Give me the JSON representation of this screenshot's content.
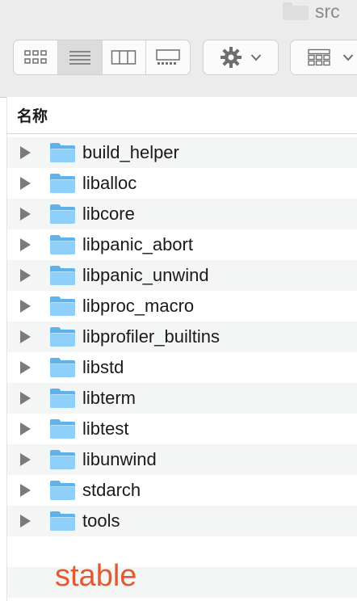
{
  "window": {
    "title": "src"
  },
  "toolbar": {
    "view_modes": [
      {
        "name": "icon-view",
        "active": false
      },
      {
        "name": "list-view",
        "active": true
      },
      {
        "name": "column-view",
        "active": false
      },
      {
        "name": "gallery-view",
        "active": false
      }
    ],
    "action_icon": "gear-icon",
    "group_icon": "grid-icon"
  },
  "list": {
    "column_header": "名称",
    "items": [
      {
        "name": "build_helper"
      },
      {
        "name": "liballoc"
      },
      {
        "name": "libcore"
      },
      {
        "name": "libpanic_abort"
      },
      {
        "name": "libpanic_unwind"
      },
      {
        "name": "libproc_macro"
      },
      {
        "name": "libprofiler_builtins"
      },
      {
        "name": "libstd"
      },
      {
        "name": "libterm"
      },
      {
        "name": "libtest"
      },
      {
        "name": "libunwind"
      },
      {
        "name": "stdarch"
      },
      {
        "name": "tools"
      }
    ]
  },
  "annotation": {
    "text": "stable",
    "color": "#e35a32"
  },
  "colors": {
    "folder": "#8fd0fb",
    "folder_dark": "#5fb3ec",
    "toolbar_bg": "#ececec"
  }
}
